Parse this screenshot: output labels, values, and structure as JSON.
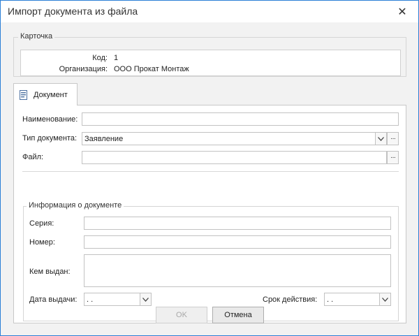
{
  "window": {
    "title": "Импорт документа из файла",
    "close_glyph": "✕"
  },
  "card": {
    "group_title": "Карточка",
    "code_label": "Код:",
    "code_value": "1",
    "org_label": "Организация:",
    "org_value": "ООО Прокат Монтаж"
  },
  "tab": {
    "label": "Документ",
    "icon": "document-icon"
  },
  "form": {
    "name_label": "Наименование:",
    "name_value": "",
    "doctype_label": "Тип документа:",
    "doctype_value": "Заявление",
    "file_label": "Файл:",
    "file_value": "",
    "ellipsis_glyph": "···"
  },
  "info": {
    "group_title": "Информация о документе",
    "series_label": "Серия:",
    "series_value": "",
    "number_label": "Номер:",
    "number_value": "",
    "issued_by_label": "Кем выдан:",
    "issued_by_value": "",
    "issue_date_label": "Дата выдачи:",
    "issue_date_value": " .  .",
    "validity_label": "Срок действия:",
    "validity_value": " .  ."
  },
  "buttons": {
    "ok": "OK",
    "cancel": "Отмена"
  }
}
